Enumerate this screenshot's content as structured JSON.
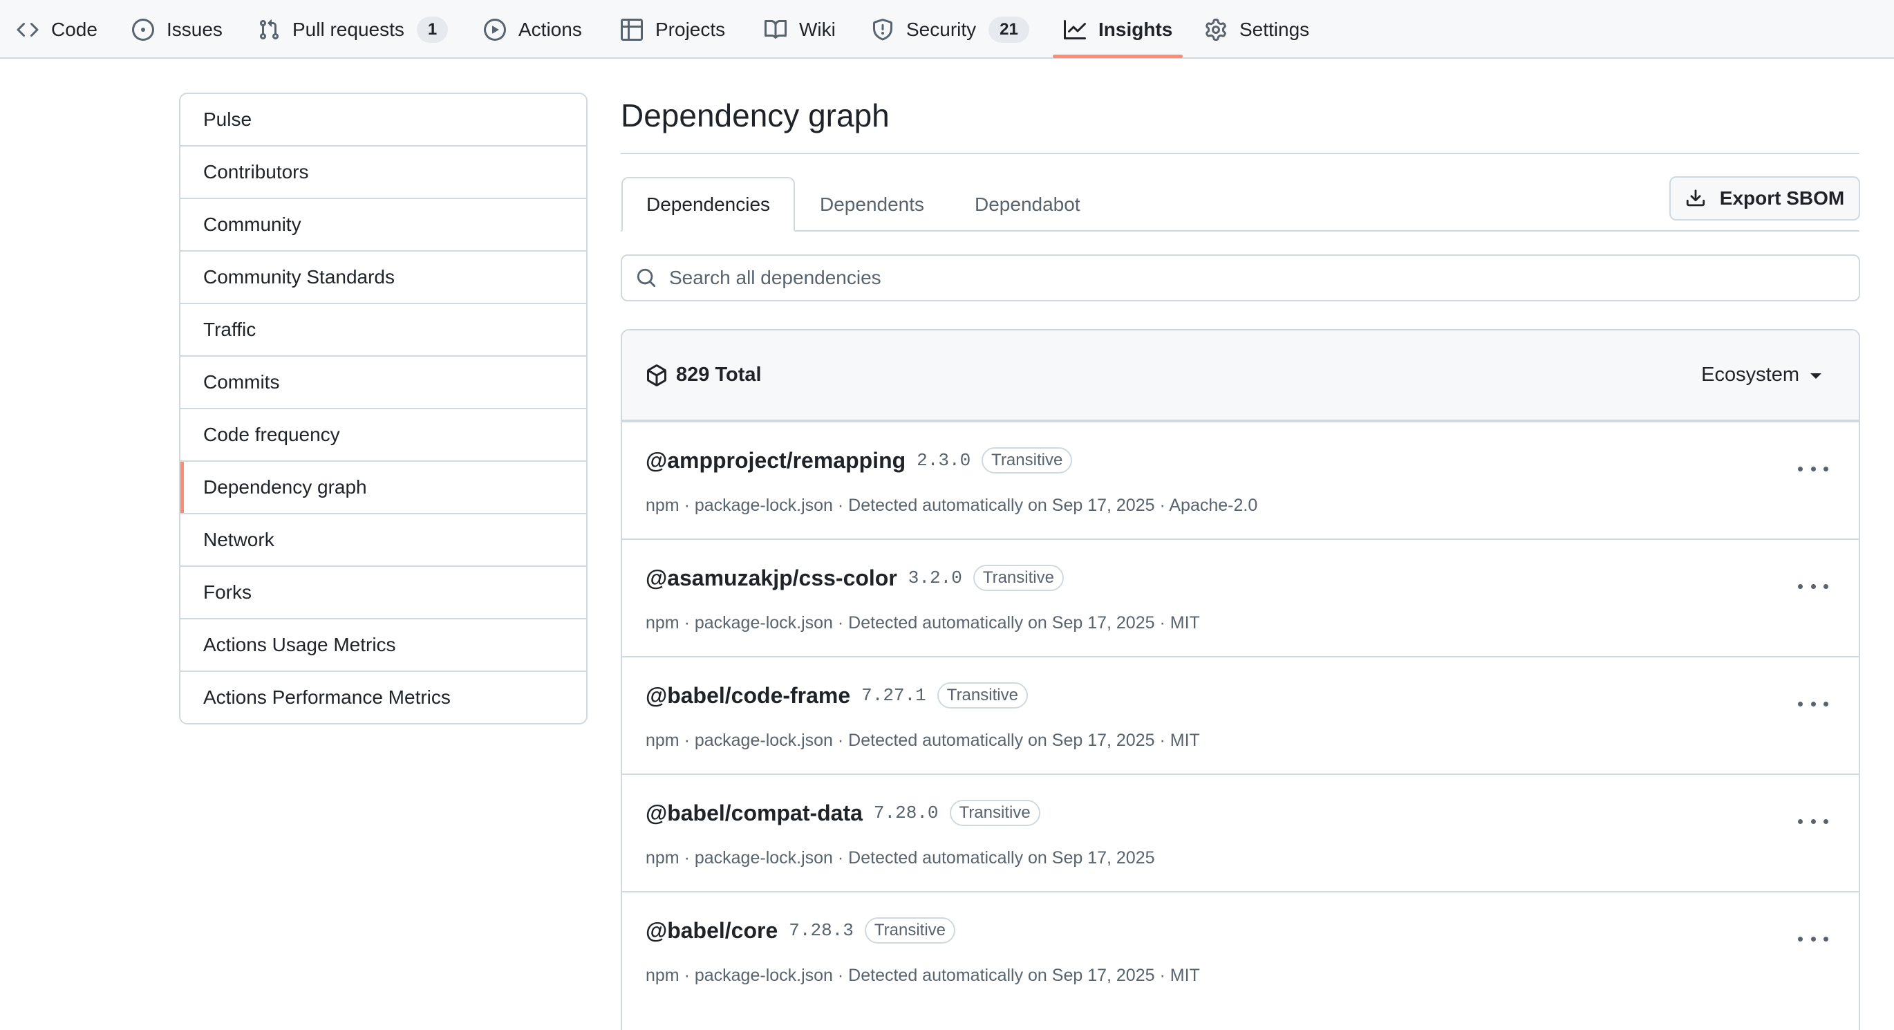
{
  "repo_nav": {
    "items": [
      {
        "label": "Code",
        "icon": "code-icon"
      },
      {
        "label": "Issues",
        "icon": "issue-icon"
      },
      {
        "label": "Pull requests",
        "icon": "pull-request-icon",
        "count": "1"
      },
      {
        "label": "Actions",
        "icon": "play-icon"
      },
      {
        "label": "Projects",
        "icon": "table-icon"
      },
      {
        "label": "Wiki",
        "icon": "book-icon"
      },
      {
        "label": "Security",
        "icon": "shield-icon",
        "count": "21"
      },
      {
        "label": "Insights",
        "icon": "graph-icon",
        "selected": true
      },
      {
        "label": "Settings",
        "icon": "gear-icon"
      }
    ]
  },
  "sidebar": {
    "items": [
      {
        "label": "Pulse"
      },
      {
        "label": "Contributors"
      },
      {
        "label": "Community"
      },
      {
        "label": "Community Standards"
      },
      {
        "label": "Traffic"
      },
      {
        "label": "Commits"
      },
      {
        "label": "Code frequency"
      },
      {
        "label": "Dependency graph",
        "selected": true
      },
      {
        "label": "Network"
      },
      {
        "label": "Forks"
      },
      {
        "label": "Actions Usage Metrics"
      },
      {
        "label": "Actions Performance Metrics"
      }
    ]
  },
  "main": {
    "title": "Dependency graph",
    "tabs": [
      {
        "label": "Dependencies",
        "selected": true
      },
      {
        "label": "Dependents"
      },
      {
        "label": "Dependabot"
      }
    ],
    "export_label": "Export SBOM",
    "search": {
      "placeholder": "Search all dependencies",
      "value": ""
    },
    "total_label": "829 Total",
    "ecosystem_label": "Ecosystem",
    "dependencies": [
      {
        "name": "@ampproject/remapping",
        "version": "2.3.0",
        "badge": "Transitive",
        "meta": "npm · package-lock.json · Detected automatically on Sep 17, 2025 · Apache-2.0"
      },
      {
        "name": "@asamuzakjp/css-color",
        "version": "3.2.0",
        "badge": "Transitive",
        "meta": "npm · package-lock.json · Detected automatically on Sep 17, 2025 · MIT"
      },
      {
        "name": "@babel/code-frame",
        "version": "7.27.1",
        "badge": "Transitive",
        "meta": "npm · package-lock.json · Detected automatically on Sep 17, 2025 · MIT"
      },
      {
        "name": "@babel/compat-data",
        "version": "7.28.0",
        "badge": "Transitive",
        "meta": "npm · package-lock.json · Detected automatically on Sep 17, 2025"
      },
      {
        "name": "@babel/core",
        "version": "7.28.3",
        "badge": "Transitive",
        "meta": "npm · package-lock.json · Detected automatically on Sep 17, 2025 · MIT"
      }
    ]
  },
  "colors": {
    "accent_underline": "#fd8c73",
    "border": "#d1d9e0",
    "muted_text": "#59636e",
    "text": "#1f2328"
  }
}
